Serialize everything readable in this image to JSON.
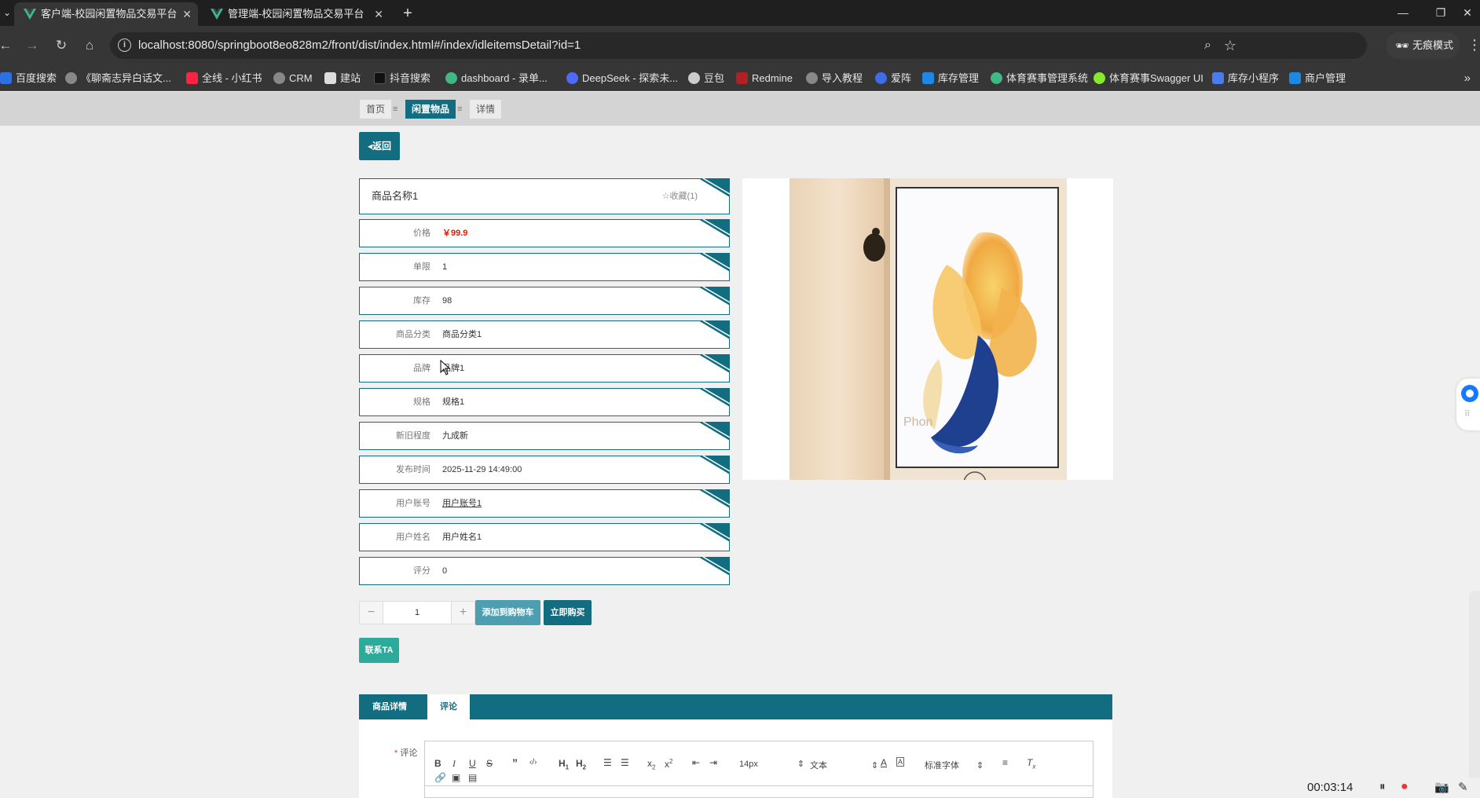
{
  "browser": {
    "tabs": [
      {
        "title": "客户端-校园闲置物品交易平台",
        "active": true
      },
      {
        "title": "管理端-校园闲置物品交易平台",
        "active": false
      }
    ],
    "url": "localhost:8080/springboot8eo828m2/front/dist/index.html#/index/idleitemsDetail?id=1",
    "incognito_label": "无痕模式",
    "bookmarks": [
      "百度搜索",
      "《聊斋志异白话文...",
      "全线 - 小红书",
      "CRM",
      "建站",
      "抖音搜索",
      "dashboard - 录单...",
      "DeepSeek - 探索未...",
      "豆包",
      "Redmine",
      "导入教程",
      "爱阵",
      "库存管理",
      "体育赛事管理系统",
      "体育赛事Swagger UI",
      "库存小程序",
      "商户管理"
    ]
  },
  "breadcrumb": {
    "home": "首页",
    "category": "闲置物品",
    "current": "详情",
    "sep": "≡"
  },
  "back_label": "返回",
  "product": {
    "name": "商品名称1",
    "favorite": "☆收藏(1)",
    "fields": [
      {
        "label": "价格",
        "value": "￥99.9"
      },
      {
        "label": "单限",
        "value": "1"
      },
      {
        "label": "库存",
        "value": "98"
      },
      {
        "label": "商品分类",
        "value": "商品分类1"
      },
      {
        "label": "品牌",
        "value": "品牌1"
      },
      {
        "label": "规格",
        "value": "规格1"
      },
      {
        "label": "新旧程度",
        "value": "九成新"
      },
      {
        "label": "发布时间",
        "value": "2025-11-29 14:49:00"
      },
      {
        "label": "用户账号",
        "value": "用户账号1"
      },
      {
        "label": "用户姓名",
        "value": "用户姓名1"
      },
      {
        "label": "评分",
        "value": "0"
      }
    ]
  },
  "quantity": {
    "value": "1",
    "minus": "−",
    "plus": "+"
  },
  "buttons": {
    "add_cart": "添加到购物车",
    "buy_now": "立即购买",
    "contact": "联系TA"
  },
  "detail_tabs": [
    {
      "label": "商品详情",
      "active": false
    },
    {
      "label": "评论",
      "active": true
    }
  ],
  "comment_form": {
    "required_mark": "*",
    "label": "评论"
  },
  "editor_toolbar": {
    "font_size": "14px",
    "header": "文本",
    "font_family": "标准字体"
  },
  "recorder": {
    "time": "00:03:14"
  },
  "colors": {
    "primary": "#136d80",
    "price": "#d81e06",
    "contact": "#2cab9b",
    "cart": "#4d9eb0"
  }
}
